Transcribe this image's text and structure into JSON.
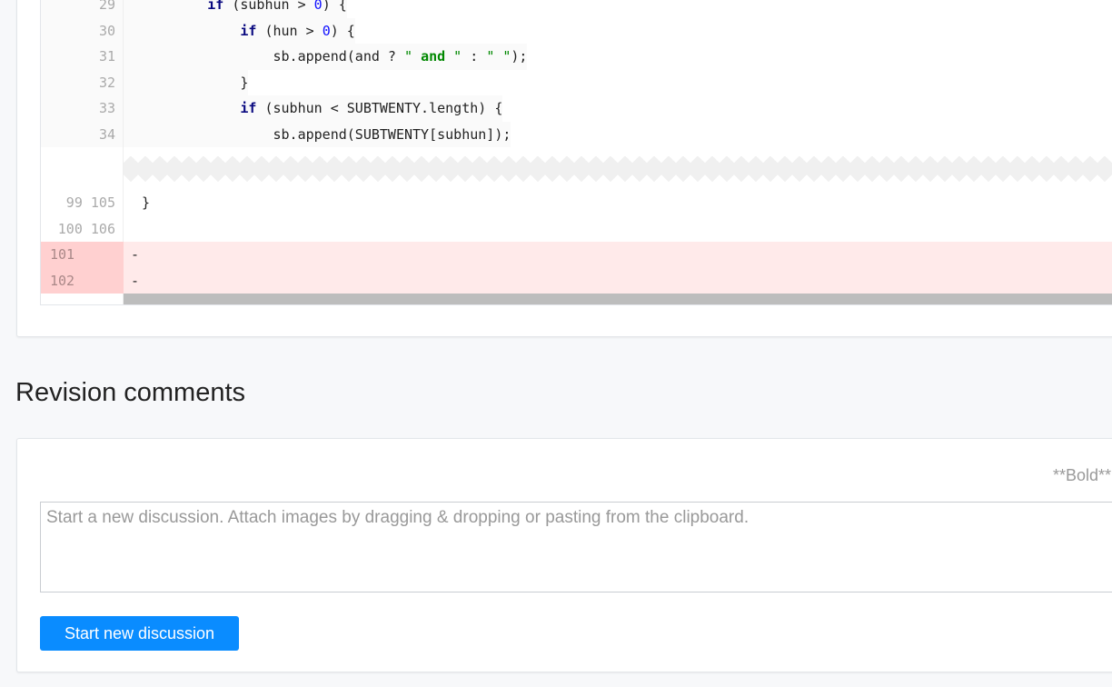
{
  "diff": {
    "context_lines": [
      {
        "ln": "29",
        "indent": "        ",
        "parts": [
          [
            "kw",
            "if"
          ],
          [
            "",
            "(subhun > "
          ],
          [
            "num",
            "0"
          ],
          [
            "",
            ") {"
          ]
        ]
      },
      {
        "ln": "30",
        "indent": "            ",
        "parts": [
          [
            "kw",
            "if"
          ],
          [
            "",
            "(hun > "
          ],
          [
            "num",
            "0"
          ],
          [
            "",
            ") {"
          ]
        ]
      },
      {
        "ln": "31",
        "indent": "                ",
        "parts": [
          [
            "",
            "sb.append(and ? "
          ],
          [
            "str",
            "\" "
          ],
          [
            "strb",
            "and"
          ],
          [
            "str",
            " \""
          ],
          [
            "",
            " : "
          ],
          [
            "str",
            "\" \""
          ],
          [
            "",
            ");"
          ]
        ]
      },
      {
        "ln": "32",
        "indent": "            ",
        "parts": [
          [
            "",
            "}"
          ]
        ]
      },
      {
        "ln": "33",
        "indent": "            ",
        "parts": [
          [
            "kw",
            "if"
          ],
          [
            "",
            "(subhun < SUBTWENTY.length) {"
          ]
        ]
      },
      {
        "ln": "34",
        "indent": "                ",
        "parts": [
          [
            "",
            "sb.append(SUBTWENTY[subhun]);"
          ]
        ]
      }
    ],
    "after_fold": [
      {
        "ln": " 99 105",
        "code": "}"
      },
      {
        "ln": "100 106",
        "code": ""
      }
    ],
    "deleted": [
      {
        "ln": "101",
        "code": "-"
      },
      {
        "ln": "102",
        "code": "-"
      }
    ]
  },
  "comments": {
    "title": "Revision comments",
    "format_hint": "**Bold**",
    "placeholder": "Start a new discussion. Attach images by dragging & dropping or pasting from the clipboard.",
    "value": "",
    "submit_label": "Start new discussion"
  },
  "colors": {
    "accent": "#0a8cff",
    "deleted_bg": "#ffeaea",
    "deleted_gutter": "#ffd0d0"
  }
}
